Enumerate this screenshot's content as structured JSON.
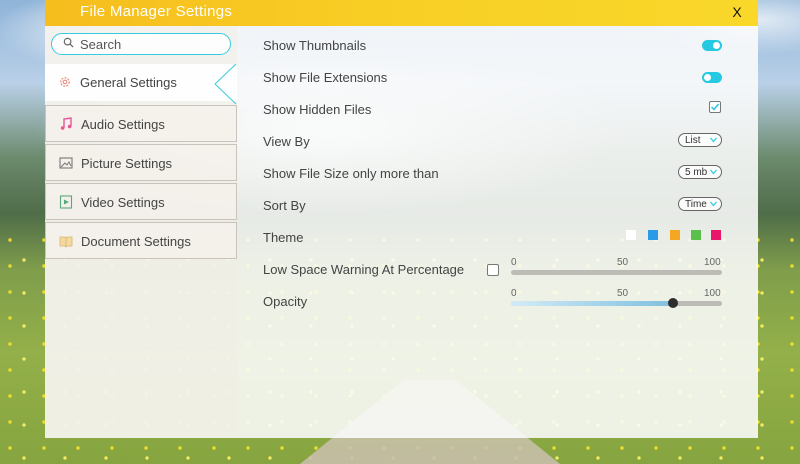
{
  "window": {
    "title": "File Manager Settings",
    "close_label": "X"
  },
  "search": {
    "placeholder": "Search"
  },
  "sidebar": {
    "items": [
      {
        "label": "General Settings",
        "icon": "gear-icon",
        "active": true
      },
      {
        "label": "Audio Settings",
        "icon": "music-note-icon",
        "active": false
      },
      {
        "label": "Picture Settings",
        "icon": "picture-icon",
        "active": false
      },
      {
        "label": "Video Settings",
        "icon": "video-icon",
        "active": false
      },
      {
        "label": "Document Settings",
        "icon": "document-icon",
        "active": false
      }
    ]
  },
  "settings": {
    "show_thumbnails": {
      "label": "Show Thumbnails",
      "on": true
    },
    "show_extensions": {
      "label": "Show File Extensions",
      "on": false
    },
    "show_hidden": {
      "label": "Show Hidden Files",
      "checked": true
    },
    "view_by": {
      "label": "View By",
      "value": "List"
    },
    "file_size": {
      "label": "Show File Size only more than",
      "value": "5 mb"
    },
    "sort_by": {
      "label": "Sort By",
      "value": "Time"
    },
    "theme": {
      "label": "Theme",
      "colors": [
        "#ffffff",
        "#2b9be6",
        "#f5a623",
        "#5bbf4c",
        "#e8176b"
      ]
    },
    "low_space": {
      "label": "Low Space Warning At Percentage",
      "checked": false,
      "value": 0
    },
    "opacity": {
      "label": "Opacity",
      "value": 77
    },
    "scale": {
      "min": "0",
      "mid": "50",
      "max": "100"
    }
  },
  "colors": {
    "accent": "#26c9e2",
    "title_bar": "#f8cf25"
  }
}
